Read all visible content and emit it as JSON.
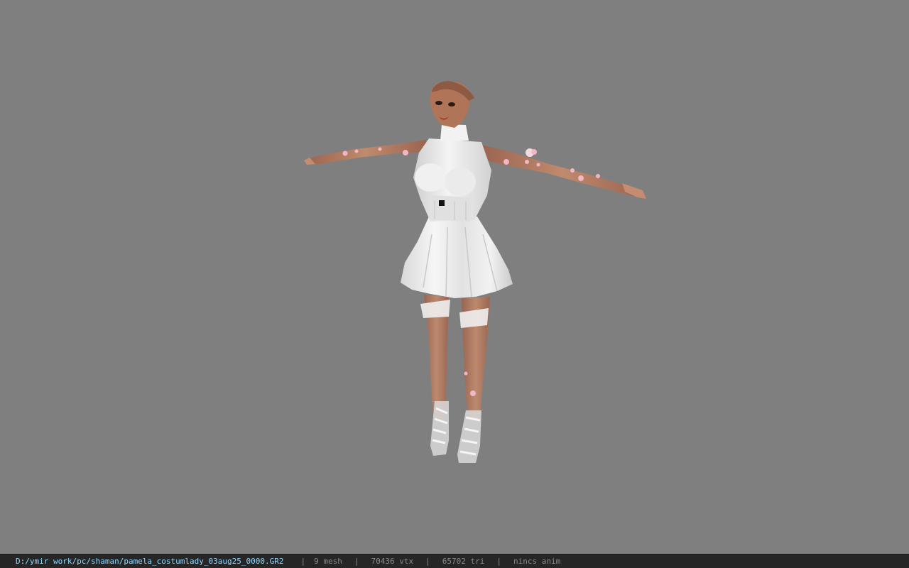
{
  "status_bar": {
    "file_path": "D:/ymir work/pc/shaman/pamela_costumlady_03aug25_0000.GR2",
    "separator": "|",
    "mesh_count": "9 mesh",
    "vertex_count": "70436 vtx",
    "triangle_count": "65702 tri",
    "anim_status": "nincs anim"
  },
  "viewport": {
    "background_color": "#7f7f7f",
    "model_subject": "female-character-white-dress-tpose"
  },
  "colors": {
    "skin": "#b27a60",
    "dress": "#e9e9e9",
    "accent_flowers": "#f2b6c6"
  }
}
